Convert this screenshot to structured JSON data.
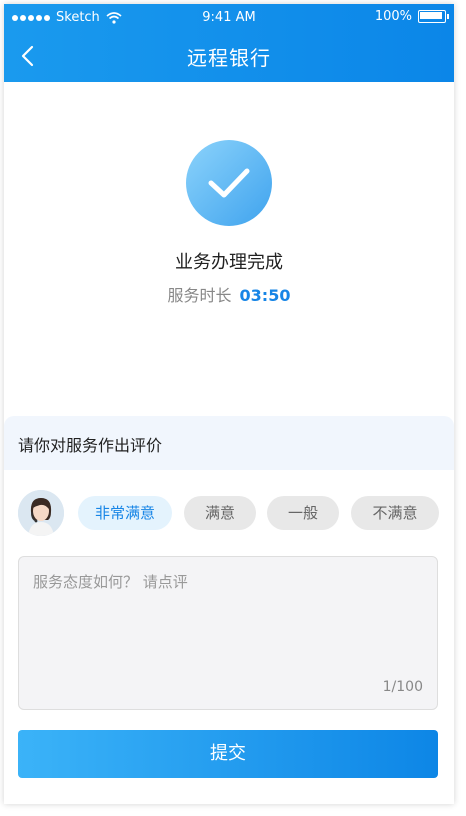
{
  "status_bar": {
    "carrier": "Sketch",
    "time": "9:41 AM",
    "battery": "100%"
  },
  "nav": {
    "title": "远程银行",
    "back_icon": "chevron-left-icon"
  },
  "result": {
    "title": "业务办理完成",
    "duration_label": "服务时长",
    "duration_value": "03:50",
    "icon": "check-icon"
  },
  "rating": {
    "prompt": "请你对服务作出评价",
    "options": [
      "非常满意",
      "满意",
      "一般",
      "不满意"
    ],
    "selected_index": 0
  },
  "comment": {
    "placeholder": "服务态度如何？ 请点评",
    "counter": "1/100"
  },
  "submit_label": "提交",
  "colors": {
    "primary": "#1785e6",
    "header": "#1a9aee",
    "chip_selected_bg": "#e4f3fd"
  }
}
